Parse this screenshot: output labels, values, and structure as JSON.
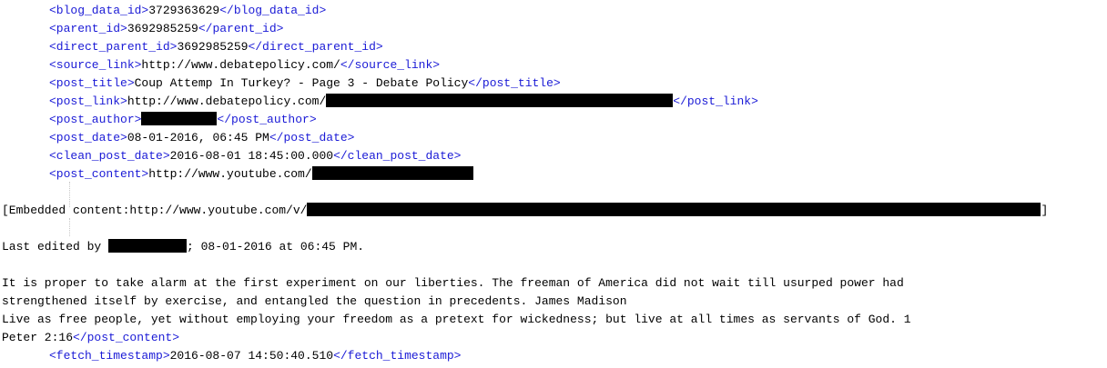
{
  "xml": {
    "blog_data_id": {
      "open": "<blog_data_id>",
      "value": "3729363629",
      "close": "</blog_data_id>"
    },
    "parent_id": {
      "open": "<parent_id>",
      "value": "3692985259",
      "close": "</parent_id>"
    },
    "direct_parent_id": {
      "open": "<direct_parent_id>",
      "value": "3692985259",
      "close": "</direct_parent_id>"
    },
    "source_link": {
      "open": "<source_link>",
      "value": "http://www.debatepolicy.com/",
      "close": "</source_link>"
    },
    "post_title": {
      "open": "<post_title>",
      "value": "Coup Attemp In Turkey? - Page 3 - Debate Policy",
      "close": "</post_title>"
    },
    "post_link": {
      "open": "<post_link>",
      "value": "http://www.debatepolicy.com/",
      "close": "</post_link>"
    },
    "post_author": {
      "open": "<post_author>",
      "value": "",
      "close": "</post_author>"
    },
    "post_date": {
      "open": "<post_date>",
      "value": "08-01-2016, 06:45 PM",
      "close": "</post_date>"
    },
    "clean_post_date": {
      "open": "<clean_post_date>",
      "value": "2016-08-01 18:45:00.000",
      "close": "</clean_post_date>"
    },
    "post_content": {
      "open": "<post_content>",
      "value": "http://www.youtube.com/",
      "embedded_prefix": "[Embedded content:http://www.youtube.com/v/",
      "embedded_suffix": "]",
      "edited_before": "Last edited by ",
      "edited_after": "; 08-01-2016 at 06:45 PM.",
      "para1_line1": "It is proper to take alarm at the first experiment on our liberties. The freeman of America did not wait till usurped power had",
      "para1_line2": "strengthened itself by exercise, and entangled the question in precedents. James Madison",
      "para2_line1": "Live as free people, yet without employing your freedom as a pretext for wickedness; but live at all times as servants of God. 1",
      "para2_line2": "Peter 2:16",
      "close": "</post_content>"
    },
    "fetch_timestamp": {
      "open": "<fetch_timestamp>",
      "value": "2016-08-07 14:50:40.510",
      "close": "</fetch_timestamp>"
    }
  }
}
